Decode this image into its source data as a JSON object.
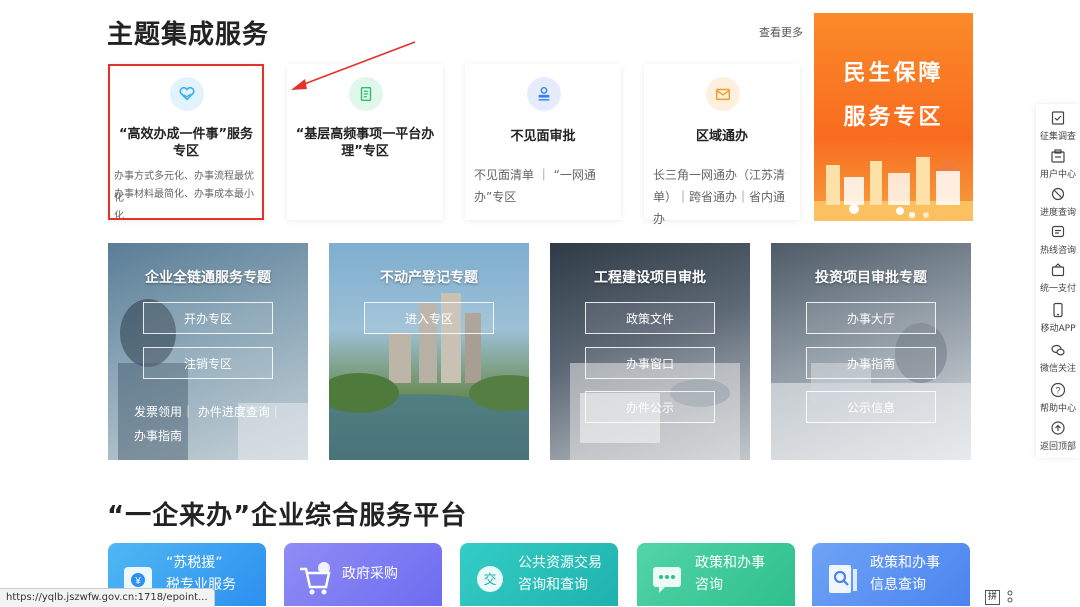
{
  "section1": {
    "title": "主题集成服务",
    "more": "查看更多",
    "cards": [
      {
        "title": "“高效办成一件事”服务专区",
        "desc": [
          "办事方式多元化、办事流程最优化",
          "办事材料最简化、办事成本最小化"
        ],
        "icon": "heart-hands-icon",
        "color": "#3bb0f0"
      },
      {
        "title": "“基层高频事项一平台办理”专区",
        "desc": [],
        "icon": "document-icon",
        "color": "#2fbf71"
      },
      {
        "title": "不见面审批",
        "desc": [
          "不见面清单 ｜ “一网通",
          "办”专区"
        ],
        "icon": "stamp-icon",
        "color": "#3b7cf0"
      },
      {
        "title": "区域通办",
        "desc": [
          "长三角一网通办（江苏清",
          "单）｜跨省通办｜省内通办"
        ],
        "icon": "mail-icon",
        "color": "#f39a2b"
      }
    ],
    "banner": {
      "line1": "民生保障",
      "line2": "服务专区"
    }
  },
  "tiles": [
    {
      "title": "企业全链通服务专题",
      "buttons": [
        "开办专区",
        "注销专区"
      ],
      "links": "发票领用｜ 办件进度查询｜",
      "links2": "办事指南"
    },
    {
      "title": "不动产登记专题",
      "buttons": [
        "进入专区"
      ]
    },
    {
      "title": "工程建设项目审批",
      "buttons": [
        "政策文件",
        "办事窗口",
        "办件公示"
      ]
    },
    {
      "title": "投资项目审批专题",
      "buttons": [
        "办事大厅",
        "办事指南",
        "公示信息"
      ]
    }
  ],
  "section2": {
    "title": "“一企来办”企业综合服务平台",
    "cards": [
      {
        "line1": "“苏税援”",
        "line2": "税专业服务",
        "icon": "tax-icon"
      },
      {
        "line1": "政府采购",
        "line2": "",
        "icon": "cart-icon"
      },
      {
        "line1": "公共资源交易",
        "line2": "咨询和查询",
        "icon": "exchange-icon"
      },
      {
        "line1": "政策和办事",
        "line2": "咨询",
        "icon": "chat-icon"
      },
      {
        "line1": "政策和办事",
        "line2": "信息查询",
        "icon": "search-doc-icon"
      }
    ]
  },
  "sidebar": [
    {
      "label": "征集调查",
      "icon": "survey-icon"
    },
    {
      "label": "用户中心",
      "icon": "user-center-icon"
    },
    {
      "label": "进度查询",
      "icon": "progress-icon"
    },
    {
      "label": "热线咨询",
      "icon": "hotline-icon"
    },
    {
      "label": "统一支付",
      "icon": "payment-icon"
    },
    {
      "label": "移动APP",
      "icon": "mobile-icon"
    },
    {
      "label": "微信关注",
      "icon": "wechat-icon"
    },
    {
      "label": "帮助中心",
      "icon": "help-icon"
    },
    {
      "label": "返回顶部",
      "icon": "back-to-top-icon"
    }
  ],
  "status_url": "https://yqlb.jszwfw.gov.cn:1718/epoint...",
  "ime": "拼"
}
